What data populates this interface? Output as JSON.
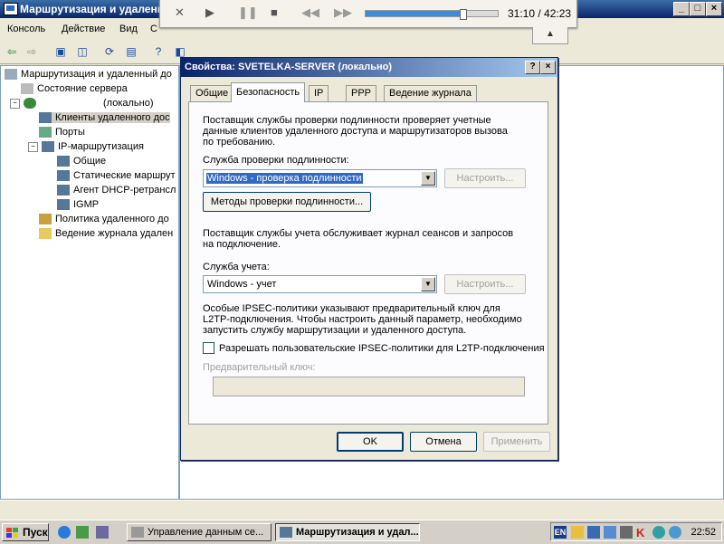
{
  "main_window": {
    "title": "Маршрутизация и удаленн",
    "menu": [
      "Консоль",
      "Действие",
      "Вид",
      "С"
    ]
  },
  "player": {
    "time": "31:10 / 42:23",
    "progress": 0.735
  },
  "tree": {
    "items": [
      "Маршрутизация и удаленный до",
      "Состояние сервера",
      "(локально)",
      "Клиенты удаленного дос",
      "Порты",
      "IP-маршрутизация",
      "Общие",
      "Статические маршрут",
      "Агент DHCP-ретрансл",
      "IGMP",
      "Политика удаленного до",
      "Ведение журнала удален"
    ]
  },
  "dialog": {
    "title": "Свойства: SVETELKA-SERVER (локально)",
    "help": "?",
    "close": "×",
    "tabs": [
      "Общие",
      "Безопасность",
      "IP",
      "PPP",
      "Ведение журнала"
    ],
    "auth_desc": [
      "Поставщик службы проверки подлинности проверяет учетные",
      "данные клиентов удаленного доступа и маршрутизаторов вызова",
      "по требованию."
    ],
    "auth_label": "Служба проверки подлинности:",
    "auth_value": "Windows - проверка подлинности",
    "configure": "Настроить...",
    "auth_methods": "Методы проверки подлинности...",
    "acct_desc": [
      "Поставщик службы учета обслуживает журнал сеансов и запросов",
      "на подключение."
    ],
    "acct_label": "Служба учета:",
    "acct_value": "Windows - учет",
    "ipsec_desc": [
      "Особые IPSEC-политики указывают предварительный ключ для",
      "L2TP-подключения.  Чтобы настроить данный параметр, необходимо",
      "запустить службу маршрутизации и удаленного доступа."
    ],
    "ipsec_checkbox": "Разрешать пользовательские IPSEC-политики для L2TP-подключения",
    "ipsec_checked": false,
    "psk_label": "Предварительный ключ:",
    "ok": "OK",
    "cancel": "Отмена",
    "apply": "Применить"
  },
  "taskbar": {
    "start": "Пуск",
    "tasks": [
      "Управление данным се...",
      "Маршрутизация и удал..."
    ],
    "lang": "EN",
    "clock": "22:52"
  },
  "colors": {
    "title_active": "#0a246a",
    "selection": "#316ac5",
    "seek_fill": "#3a8edb"
  }
}
